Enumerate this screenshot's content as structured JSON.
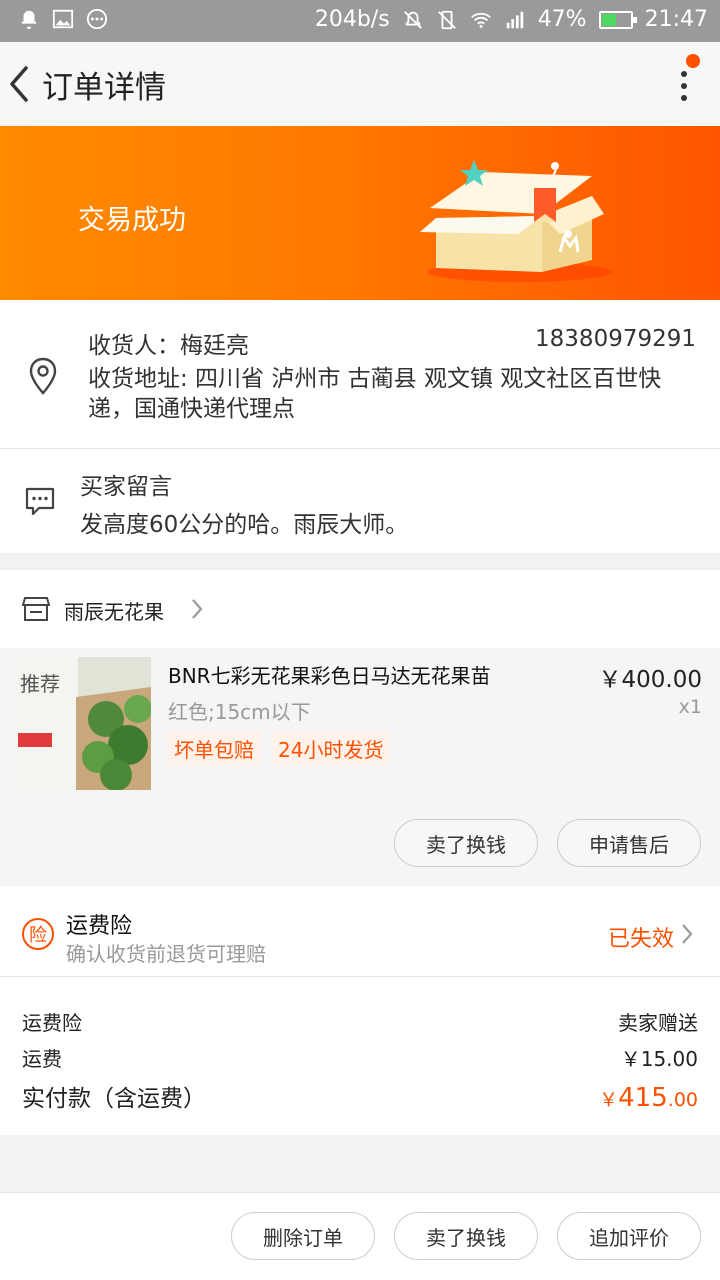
{
  "status_bar": {
    "speed": "204b/s",
    "battery": "47%",
    "battery_level": 0.47,
    "time": "21:47"
  },
  "header": {
    "title": "订单详情"
  },
  "banner": {
    "status": "交易成功"
  },
  "address": {
    "receiver": "收货人：梅廷亮",
    "phone": "18380979291",
    "address": "收货地址: 四川省 泸州市 古蔺县 观文镇 观文社区百世快递，国通快递代理点"
  },
  "buyer_message": {
    "label": "买家留言",
    "text": "发高度60公分的哈。雨辰大师。"
  },
  "shop": {
    "name": "雨辰无花果"
  },
  "item": {
    "thumb_text": "推荐",
    "title": "BNR七彩无花果彩色日马达无花果苗",
    "sku": "红色;15cm以下",
    "tags": [
      "坏单包赔",
      "24小时发货"
    ],
    "price": "￥400.00",
    "qty": "x1",
    "actions": {
      "sell": "卖了换钱",
      "after_sale": "申请售后"
    }
  },
  "insurance": {
    "title": "运费险",
    "badge": "险",
    "desc": "确认收货前退货可理赔",
    "state": "已失效"
  },
  "summary": {
    "rows": [
      {
        "label": "运费险",
        "value": "卖家赠送"
      },
      {
        "label": "运费",
        "value": "￥15.00"
      }
    ],
    "total_label": "实付款（含运费）",
    "total_currency": "￥",
    "total_int": "415",
    "total_dec": ".00"
  },
  "bottom_actions": {
    "delete": "删除订单",
    "sell": "卖了换钱",
    "review": "追加评价"
  },
  "colors": {
    "accent": "#ff5000",
    "banner_start": "#ff8a00",
    "banner_end": "#ff5500"
  }
}
